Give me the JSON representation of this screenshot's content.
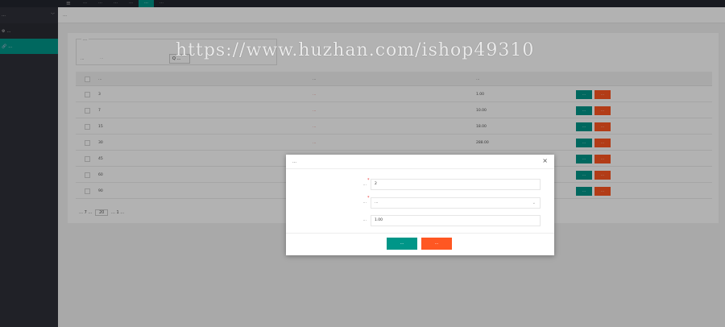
{
  "header": {
    "menu_icon": "menu-icon",
    "nav": [
      {
        "label": "…",
        "active": false
      },
      {
        "label": "…",
        "active": false
      },
      {
        "label": "…",
        "active": false
      },
      {
        "label": "…",
        "active": false
      },
      {
        "label": "…",
        "active": true
      },
      {
        "label": "…",
        "active": false
      }
    ]
  },
  "sidebar": {
    "group_label": "…",
    "items": [
      {
        "label": "…",
        "icon": "gear-icon",
        "active": false
      },
      {
        "label": "…",
        "icon": "link-icon",
        "active": true
      }
    ]
  },
  "breadcrumb": "…",
  "search": {
    "legend": "…",
    "label": "…",
    "placeholder": "…",
    "button": "Q …"
  },
  "table": {
    "columns": [
      "…",
      "…",
      "…"
    ],
    "rows": [
      {
        "num": "3",
        "type": "…",
        "amount": "1.00",
        "type_color": "red"
      },
      {
        "num": "7",
        "type": "…",
        "amount": "10.00",
        "type_color": "red"
      },
      {
        "num": "15",
        "type": "…",
        "amount": "18.00",
        "type_color": "red"
      },
      {
        "num": "30",
        "type": "…",
        "amount": "288.00",
        "type_color": "red"
      },
      {
        "num": "45",
        "type": "",
        "amount": "",
        "type_color": "red"
      },
      {
        "num": "60",
        "type": "",
        "amount": "",
        "type_color": "red"
      },
      {
        "num": "90",
        "type": "",
        "amount": "",
        "type_color": "red"
      }
    ],
    "edit_label": "…",
    "delete_label": "…"
  },
  "pager": {
    "text_before": "… 7 …",
    "page_size": "20",
    "text_after": "… 1 …"
  },
  "modal": {
    "title": "…",
    "close_icon": "close-icon",
    "fields": [
      {
        "label": "…",
        "value": "2",
        "required": true
      },
      {
        "label": "…",
        "value": "…",
        "required": true,
        "type": "select"
      },
      {
        "label": "…",
        "value": "1.00",
        "required": false
      }
    ],
    "save_label": "…",
    "cancel_label": "…"
  },
  "watermark": "https://www.huzhan.com/ishop49310",
  "colors": {
    "accent": "#009688",
    "danger": "#ff5722",
    "sidebar": "#2f3039",
    "topbar": "#23262e"
  }
}
